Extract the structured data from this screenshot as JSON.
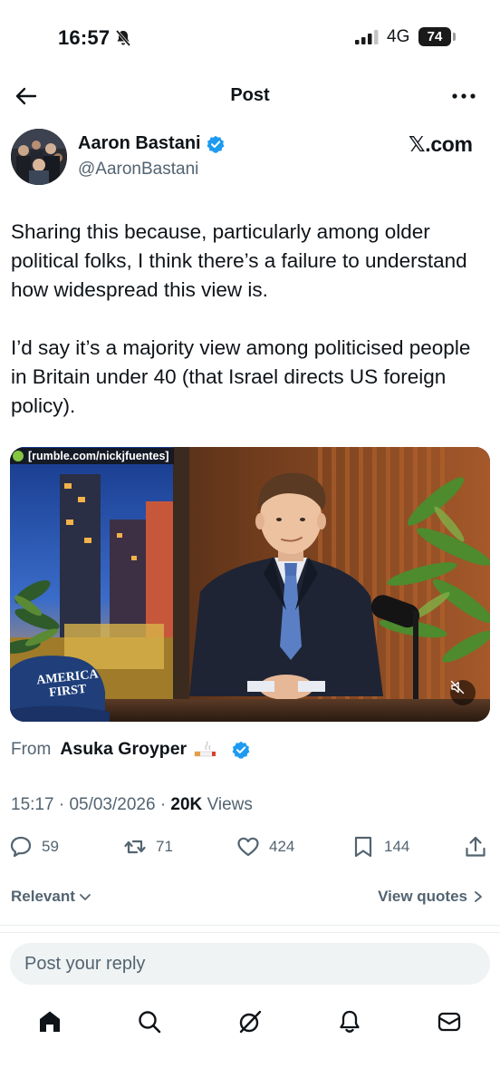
{
  "status_bar": {
    "time": "16:57",
    "network": "4G",
    "battery": "74"
  },
  "header": {
    "title": "Post"
  },
  "author": {
    "name": "Aaron Bastani",
    "handle": "@AaronBastani",
    "source": "𝕏.com"
  },
  "post": {
    "paragraphs": [
      "Sharing this because, particularly among older political folks, I think there’s a failure to understand how widespread this view is.",
      "I’d say it’s a majority view among politicised people in Britain under 40 (that Israel directs US foreign policy)."
    ],
    "media": {
      "watermark": "[rumble.com/nickjfuentes]",
      "hat_text": "AMERICA FIRST"
    },
    "from_label": "From",
    "from_name": "Asuka Groyper",
    "time": "15:17",
    "date": "05/03/2026",
    "views_count": "20K",
    "views_label": "Views"
  },
  "actions": {
    "replies": "59",
    "reposts": "71",
    "likes": "424",
    "bookmarks": "144"
  },
  "sort": {
    "relevant": "Relevant",
    "view_quotes": "View quotes"
  },
  "reply": {
    "placeholder": "Post your reply"
  },
  "colors": {
    "verified": "#1d9bf0",
    "muted_text": "#536471",
    "text": "#0f1419",
    "reply_bg": "#eff3f4"
  },
  "icons": {
    "back": "arrow-left-icon",
    "more": "more-horizontal-icon",
    "reply": "comment-icon",
    "repost": "repost-icon",
    "like": "heart-icon",
    "bookmark": "bookmark-icon",
    "share": "share-icon",
    "home": "home-icon",
    "search": "search-icon",
    "grok": "grok-icon",
    "notifications": "bell-icon",
    "messages": "mail-icon"
  }
}
